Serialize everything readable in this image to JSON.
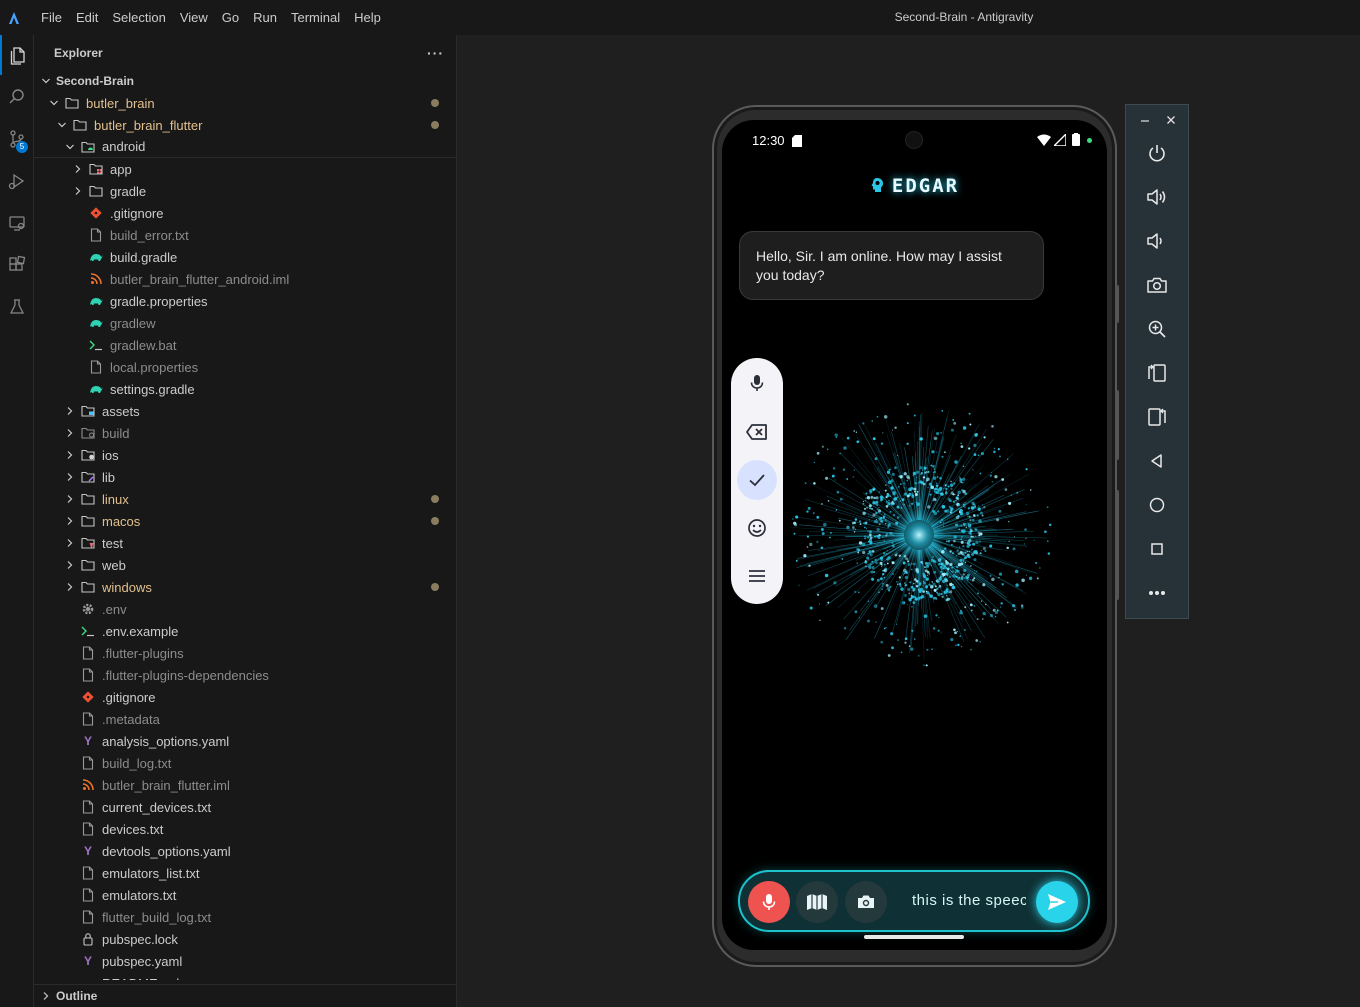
{
  "window": {
    "title": "Second-Brain - Antigravity",
    "menu": [
      "File",
      "Edit",
      "Selection",
      "View",
      "Go",
      "Run",
      "Terminal",
      "Help"
    ]
  },
  "activity_bar": {
    "icons": [
      "explorer-icon",
      "search-icon",
      "source-control-icon",
      "run-debug-icon",
      "remote-explorer-icon",
      "extensions-icon",
      "testing-icon"
    ],
    "source_control_badge": "5"
  },
  "sidebar": {
    "title": "Explorer",
    "more": "···",
    "root": "Second-Brain",
    "items": [
      {
        "label": "butler_brain",
        "indent": 1,
        "type": "folder",
        "open": true,
        "status": "modified"
      },
      {
        "label": "butler_brain_flutter",
        "indent": 2,
        "type": "folder",
        "open": true,
        "status": "modified"
      },
      {
        "label": "android",
        "indent": 3,
        "type": "folder-android",
        "open": true,
        "status": "normal"
      },
      {
        "label": "app",
        "indent": 4,
        "type": "folder-app",
        "open": false,
        "status": "normal"
      },
      {
        "label": "gradle",
        "indent": 4,
        "type": "folder",
        "open": false,
        "status": "normal"
      },
      {
        "label": ".gitignore",
        "indent": 4,
        "type": "git",
        "status": "normal"
      },
      {
        "label": "build_error.txt",
        "indent": 4,
        "type": "file",
        "status": "ignored"
      },
      {
        "label": "build.gradle",
        "indent": 4,
        "type": "gradle",
        "status": "normal"
      },
      {
        "label": "butler_brain_flutter_android.iml",
        "indent": 4,
        "type": "rss",
        "status": "ignored"
      },
      {
        "label": "gradle.properties",
        "indent": 4,
        "type": "gradle",
        "status": "normal"
      },
      {
        "label": "gradlew",
        "indent": 4,
        "type": "gradle",
        "status": "ignored"
      },
      {
        "label": "gradlew.bat",
        "indent": 4,
        "type": "terminal",
        "status": "ignored"
      },
      {
        "label": "local.properties",
        "indent": 4,
        "type": "file",
        "status": "ignored"
      },
      {
        "label": "settings.gradle",
        "indent": 4,
        "type": "gradle",
        "status": "normal"
      },
      {
        "label": "assets",
        "indent": 3,
        "type": "folder-assets",
        "open": false,
        "status": "normal"
      },
      {
        "label": "build",
        "indent": 3,
        "type": "folder-build",
        "open": false,
        "status": "ignored"
      },
      {
        "label": "ios",
        "indent": 3,
        "type": "folder-ios",
        "open": false,
        "status": "normal"
      },
      {
        "label": "lib",
        "indent": 3,
        "type": "folder-lib",
        "open": false,
        "status": "normal"
      },
      {
        "label": "linux",
        "indent": 3,
        "type": "folder",
        "open": false,
        "status": "modified"
      },
      {
        "label": "macos",
        "indent": 3,
        "type": "folder",
        "open": false,
        "status": "modified"
      },
      {
        "label": "test",
        "indent": 3,
        "type": "folder-test",
        "open": false,
        "status": "normal"
      },
      {
        "label": "web",
        "indent": 3,
        "type": "folder",
        "open": false,
        "status": "normal"
      },
      {
        "label": "windows",
        "indent": 3,
        "type": "folder",
        "open": false,
        "status": "modified"
      },
      {
        "label": ".env",
        "indent": 3,
        "type": "gear",
        "status": "ignored"
      },
      {
        "label": ".env.example",
        "indent": 3,
        "type": "terminal",
        "status": "normal"
      },
      {
        "label": ".flutter-plugins",
        "indent": 3,
        "type": "file",
        "status": "ignored"
      },
      {
        "label": ".flutter-plugins-dependencies",
        "indent": 3,
        "type": "file",
        "status": "ignored"
      },
      {
        "label": ".gitignore",
        "indent": 3,
        "type": "git",
        "status": "normal"
      },
      {
        "label": ".metadata",
        "indent": 3,
        "type": "file",
        "status": "ignored"
      },
      {
        "label": "analysis_options.yaml",
        "indent": 3,
        "type": "yaml",
        "status": "normal"
      },
      {
        "label": "build_log.txt",
        "indent": 3,
        "type": "file",
        "status": "ignored"
      },
      {
        "label": "butler_brain_flutter.iml",
        "indent": 3,
        "type": "rss",
        "status": "ignored"
      },
      {
        "label": "current_devices.txt",
        "indent": 3,
        "type": "file",
        "status": "normal"
      },
      {
        "label": "devices.txt",
        "indent": 3,
        "type": "file",
        "status": "normal"
      },
      {
        "label": "devtools_options.yaml",
        "indent": 3,
        "type": "yaml",
        "status": "normal"
      },
      {
        "label": "emulators_list.txt",
        "indent": 3,
        "type": "file",
        "status": "normal"
      },
      {
        "label": "emulators.txt",
        "indent": 3,
        "type": "file",
        "status": "normal"
      },
      {
        "label": "flutter_build_log.txt",
        "indent": 3,
        "type": "file",
        "status": "ignored"
      },
      {
        "label": "pubspec.lock",
        "indent": 3,
        "type": "lock",
        "status": "normal"
      },
      {
        "label": "pubspec.yaml",
        "indent": 3,
        "type": "yaml",
        "status": "normal"
      },
      {
        "label": "README.md",
        "indent": 3,
        "type": "md",
        "status": "normal"
      }
    ],
    "outline": "Outline"
  },
  "phone": {
    "status_time": "12:30",
    "app_title": "EDGAR",
    "message": "Hello, Sir. I am online. How may I assist you today?",
    "input_text": "this is the speech",
    "keyboard_toolbar": [
      "mic-icon",
      "backspace-icon",
      "check-icon",
      "emoji-icon",
      "menu-icon"
    ],
    "input_buttons": [
      "mic-icon",
      "book-icon",
      "camera-icon",
      "send-icon"
    ]
  },
  "emulator_controls": {
    "window": [
      "minimize-icon",
      "close-icon"
    ],
    "buttons": [
      "power-icon",
      "volume-up-icon",
      "volume-down-icon",
      "screenshot-icon",
      "zoom-icon",
      "rotate-left-icon",
      "rotate-right-icon",
      "back-icon",
      "home-icon",
      "overview-icon",
      "more-icon"
    ]
  },
  "colors": {
    "accent": "#0078d4",
    "modified": "#e2c08d",
    "cyan": "#1ec2cc",
    "mic_red": "#ef5350",
    "send": "#29d3ea"
  }
}
